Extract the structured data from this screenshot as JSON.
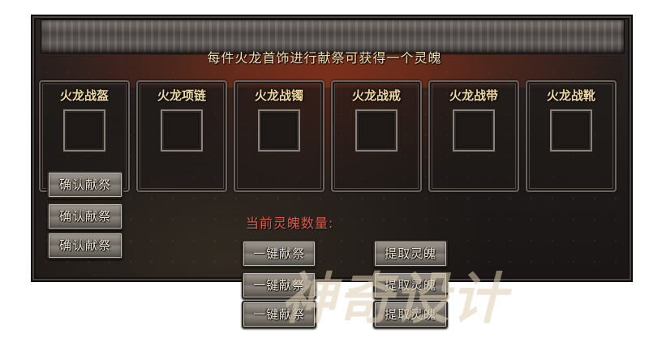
{
  "banner": {
    "text": "每件火龙首饰进行献祭可获得一个灵魄"
  },
  "slots": [
    {
      "label": "火龙战盔"
    },
    {
      "label": "火龙项链"
    },
    {
      "label": "火龙战镯"
    },
    {
      "label": "火龙战戒"
    },
    {
      "label": "火龙战带"
    },
    {
      "label": "火龙战靴"
    }
  ],
  "confirm_buttons": [
    "确认献祭",
    "确认献祭",
    "确认献祭"
  ],
  "soul": {
    "label": "当前灵魄数量:"
  },
  "one_click_buttons": [
    "一键献祭",
    "一键献祭",
    "一键献祭"
  ],
  "extract_buttons": [
    "提取灵魄",
    "提取灵魄",
    "提取灵魄"
  ],
  "watermark": {
    "text": "神奇设计"
  }
}
